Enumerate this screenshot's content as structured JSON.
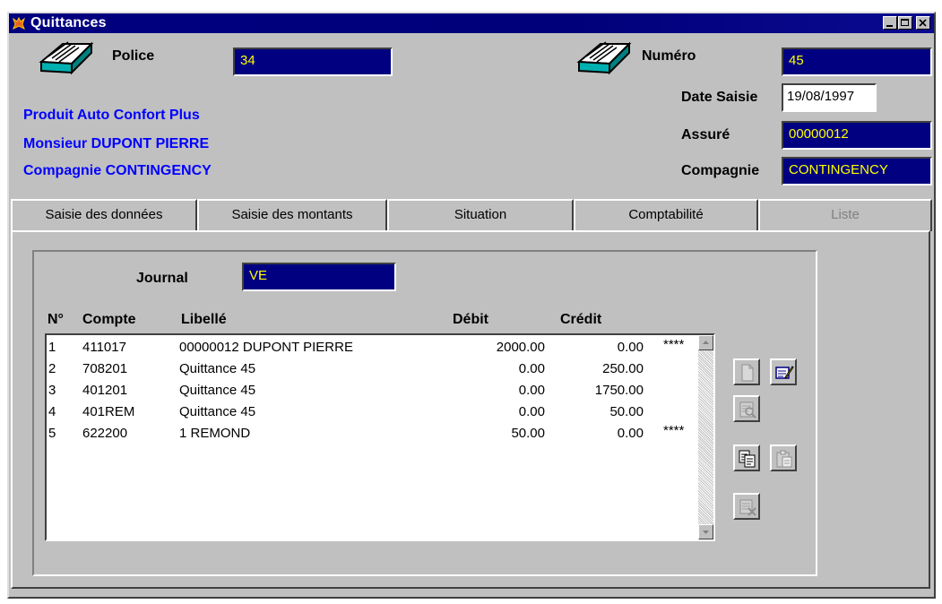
{
  "window": {
    "title": "Quittances",
    "buttons": [
      "minimize",
      "maximize",
      "close"
    ]
  },
  "header": {
    "police_label": "Police",
    "police_value": "34",
    "numero_label": "Numéro",
    "numero_value": "45",
    "date_saisie_label": "Date Saisie",
    "date_saisie_value": "19/08/1997",
    "assure_label": "Assuré",
    "assure_value": "00000012",
    "compagnie_label": "Compagnie",
    "compagnie_value": "CONTINGENCY",
    "info_lines": [
      "Produit Auto Confort Plus",
      "Monsieur DUPONT PIERRE",
      "Compagnie CONTINGENCY"
    ],
    "icon": "card-file-icon"
  },
  "tabs": [
    {
      "label": "Saisie des données",
      "active": false,
      "enabled": true
    },
    {
      "label": "Saisie des montants",
      "active": false,
      "enabled": true
    },
    {
      "label": "Situation",
      "active": false,
      "enabled": true
    },
    {
      "label": "Comptabilité",
      "active": true,
      "enabled": true
    },
    {
      "label": "Liste",
      "active": false,
      "enabled": false
    }
  ],
  "journal": {
    "label": "Journal",
    "value": "VE"
  },
  "table": {
    "columns": [
      "N°",
      "Compte",
      "Libellé",
      "Débit",
      "Crédit"
    ],
    "rows": [
      {
        "n": "1",
        "compte": "411017",
        "libelle": "00000012 DUPONT PIERRE",
        "debit": "2000.00",
        "credit": "0.00",
        "flag": "****"
      },
      {
        "n": "2",
        "compte": "708201",
        "libelle": "Quittance 45",
        "debit": "0.00",
        "credit": "250.00",
        "flag": ""
      },
      {
        "n": "3",
        "compte": "401201",
        "libelle": "Quittance 45",
        "debit": "0.00",
        "credit": "1750.00",
        "flag": ""
      },
      {
        "n": "4",
        "compte": "401REM",
        "libelle": "Quittance 45",
        "debit": "0.00",
        "credit": "50.00",
        "flag": ""
      },
      {
        "n": "5",
        "compte": "622200",
        "libelle": "1 REMOND",
        "debit": "50.00",
        "credit": "0.00",
        "flag": "****"
      }
    ]
  },
  "toolbar": {
    "icons": [
      "new-document-icon",
      "edit-icon",
      "view-icon",
      "copy-icon",
      "paste-icon",
      "delete-icon"
    ]
  },
  "colors": {
    "field_bg": "#000080",
    "field_text": "#ffff00",
    "info_text": "#0000ff",
    "face": "#c0c0c0"
  }
}
